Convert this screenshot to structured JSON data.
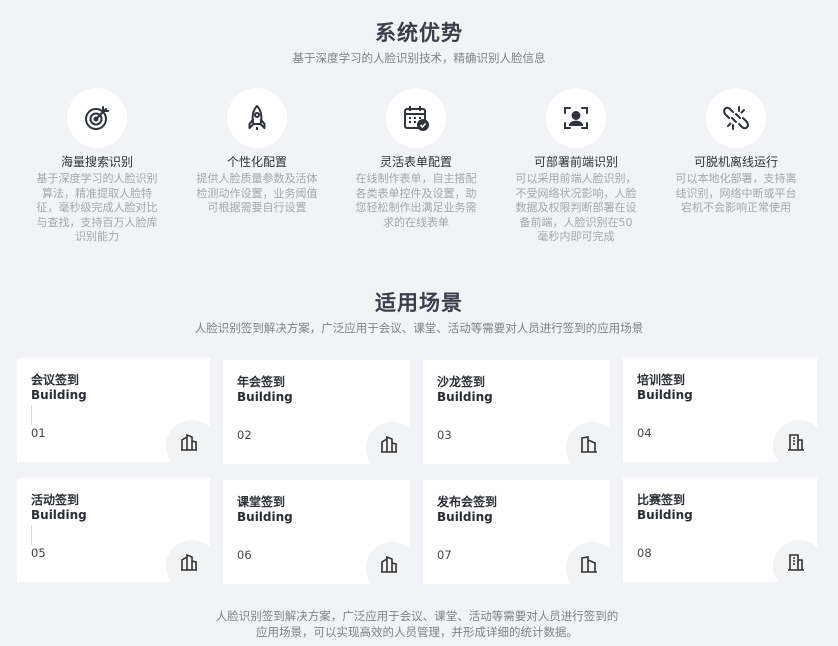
{
  "advantages": {
    "title": "系统优势",
    "subtitle": "基于深度学习的人脸识别技术，精确识别人脸信息",
    "features": [
      {
        "icon": "target-icon",
        "title": "海量搜索识别",
        "desc": "基于深度学习的人脸识别算法，精准提取人脸特征，毫秒级完成人脸对比与查找，支持百万人脸库识别能力"
      },
      {
        "icon": "rocket-icon",
        "title": "个性化配置",
        "desc": "提供人脸质量参数及活体检测动作设置，业务阈值可根据需要自行设置"
      },
      {
        "icon": "calendar-check-icon",
        "title": "灵活表单配置",
        "desc": "在线制作表单，自主搭配各类表单控件及设置，助您轻松制作出满足业务需求的在线表单"
      },
      {
        "icon": "face-scan-icon",
        "title": "可部署前端识别",
        "desc": "可以采用前端人脸识别，不受网络状况影响，人脸数据及权限判断部署在设备前端，人脸识别在50毫秒内即可完成"
      },
      {
        "icon": "broken-link-icon",
        "title": "可脱机离线运行",
        "desc": "可以本地化部署，支持离线识别，网络中断或平台宕机不会影响正常使用"
      }
    ]
  },
  "scenarios": {
    "title": "适用场景",
    "subtitle": "人脸识别签到解决方案，广泛应用于会议、课堂、活动等需要对人员进行签到的应用场景",
    "cards": [
      {
        "title": "会议签到",
        "sub": "Building",
        "num": "01",
        "icon": "buildings-icon"
      },
      {
        "title": "年会签到",
        "sub": "Building",
        "num": "02",
        "icon": "buildings-icon"
      },
      {
        "title": "沙龙签到",
        "sub": "Building",
        "num": "03",
        "icon": "buildings-icon"
      },
      {
        "title": "培训签到",
        "sub": "Building",
        "num": "04",
        "icon": "office-building-icon"
      },
      {
        "title": "活动签到",
        "sub": "Building",
        "num": "05",
        "icon": "buildings-icon"
      },
      {
        "title": "课堂签到",
        "sub": "Building",
        "num": "06",
        "icon": "buildings-icon"
      },
      {
        "title": "发布会签到",
        "sub": "Building",
        "num": "07",
        "icon": "buildings-icon"
      },
      {
        "title": "比赛签到",
        "sub": "Building",
        "num": "08",
        "icon": "office-building-icon"
      }
    ],
    "footer_line1": "人脸识别签到解决方案，广泛应用于会议、课堂、活动等需要对人员进行签到的",
    "footer_line2": "应用场景，可以实现高效的人员管理，并形成详细的统计数据。"
  }
}
